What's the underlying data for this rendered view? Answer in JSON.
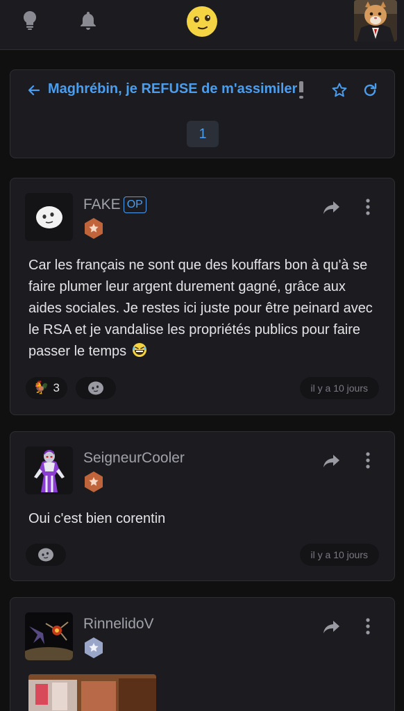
{
  "topbar": {
    "icons": [
      "lightbulb-icon",
      "bell-icon",
      "smiley-logo-icon",
      "cat-avatar"
    ]
  },
  "thread": {
    "title": "Maghrébin, je REFUSE de m'assimiler",
    "page": "1"
  },
  "posts": [
    {
      "username": "FAKE",
      "op_label": "OP",
      "rank_color": "#c0643b",
      "content": "Car les français ne sont que des kouffars bon à qu'à se faire plumer leur argent durement gagné, grâce aux aides sociales. Je restes ici juste pour être peinard avec le RSA et je vandalise les propriétés publics pour faire passer le temps",
      "reaction_count": "3",
      "time": "il y a 10 jours"
    },
    {
      "username": "SeigneurCooler",
      "rank_color": "#c0643b",
      "content": "Oui c'est bien corentin",
      "time": "il y a 10 jours"
    },
    {
      "username": "RinnelidoV",
      "rank_color": "#9aa6c8"
    }
  ],
  "colors": {
    "accent": "#4b9dee",
    "card_bg": "#1c1c20",
    "page_bg": "#101011"
  }
}
